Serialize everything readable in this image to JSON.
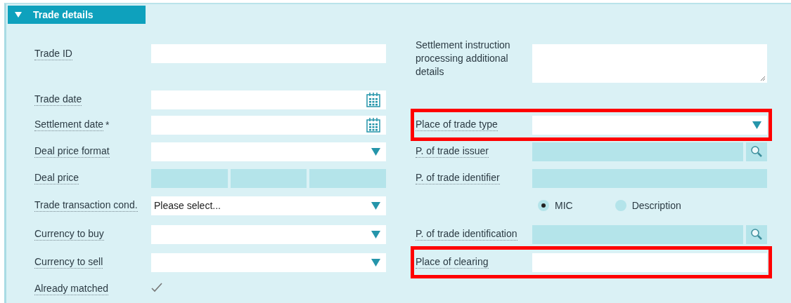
{
  "section": {
    "title": "Trade details",
    "expanded": true
  },
  "left": [
    {
      "label": "Trade ID",
      "kind": "text"
    },
    {
      "label": "Trade date",
      "kind": "date"
    },
    {
      "label": "Settlement date",
      "marker": "*",
      "kind": "date"
    },
    {
      "label": "Deal price format",
      "kind": "select"
    },
    {
      "label": "Deal price",
      "kind": "split"
    },
    {
      "label": "Trade transaction cond.",
      "kind": "select",
      "value": "Please select..."
    },
    {
      "label": "Currency to buy",
      "kind": "select"
    },
    {
      "label": "Currency to sell",
      "kind": "select"
    },
    {
      "label": "Already matched",
      "kind": "check",
      "checked": true
    }
  ],
  "right": [
    {
      "label": "Settlement instruction processing additional details",
      "kind": "textarea",
      "highlighted": false
    },
    {
      "label": "Place of trade type",
      "kind": "select",
      "highlighted": true
    },
    {
      "label": "P. of trade issuer",
      "kind": "lookup",
      "highlighted": false
    },
    {
      "label": "P. of trade identifier",
      "kind": "readonly",
      "highlighted": false
    },
    {
      "kind": "radio",
      "highlighted": false,
      "options": [
        {
          "label": "MIC",
          "selected": true
        },
        {
          "label": "Description",
          "selected": false
        }
      ]
    },
    {
      "label": "P. of trade identification",
      "kind": "lookup",
      "highlighted": false
    },
    {
      "label": "Place of clearing",
      "kind": "text",
      "highlighted": true
    }
  ]
}
